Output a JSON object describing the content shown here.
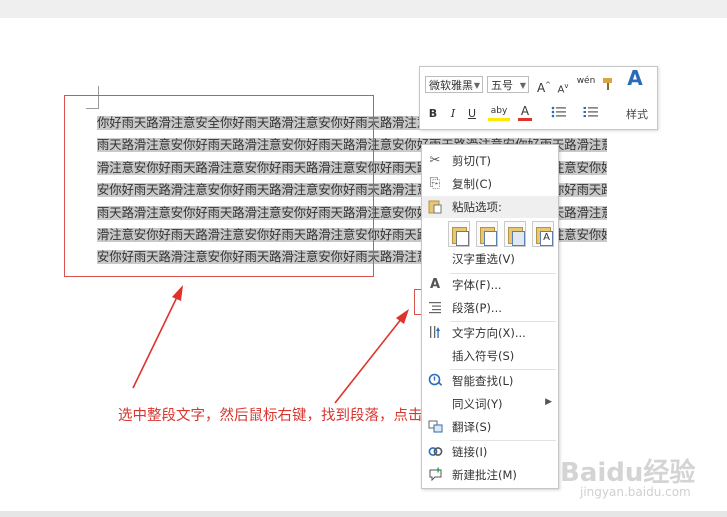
{
  "document": {
    "lines": [
      "你好雨天路滑注意安全你好雨天路滑注意安你好雨天路滑注意安你好雨天路滑注意安你好雨天路滑注意安",
      "雨天路滑注意安你好雨天路滑注意安你好雨天路滑注意安你好雨天路滑注意安你好雨天路滑注意安你好雨天路",
      "滑注意安你好雨天路滑注意安你好雨天路滑注意安你好雨天路滑注意安你好雨天路滑注意安你好雨天路滑注意",
      "安你好雨天路滑注意安你好雨天路滑注意安你好雨天路滑注意安你好雨天路滑注意安你好雨天路滑注意安你好",
      "雨天路滑注意安你好雨天路滑注意安你好雨天路滑注意安你好雨天路滑注意安你好雨天路滑注意安你好雨天路",
      "滑注意安你好雨天路滑注意安你好雨天路滑注意安你好雨天路滑注意安你好雨天路滑注意安你好雨天路滑注意",
      "安你好雨天路滑注意安你好雨天路滑注意安你好雨天路滑注意安你好雨天路滑"
    ]
  },
  "mini_toolbar": {
    "font_name": "微软雅黑",
    "font_size": "五号",
    "grow_font": "A",
    "shrink_font": "A",
    "phonetic": "wén",
    "bold": "B",
    "italic": "I",
    "underline": "U",
    "highlight": "aby",
    "font_color": "A",
    "styles_label": "样式"
  },
  "context_menu": {
    "cut": "剪切(T)",
    "copy": "复制(C)",
    "paste_options": "粘贴选项:",
    "reconvert": "汉字重选(V)",
    "font": "字体(F)...",
    "paragraph": "段落(P)...",
    "text_direction": "文字方向(X)...",
    "insert_symbol": "插入符号(S)",
    "smart_lookup": "智能查找(L)",
    "synonyms": "同义词(Y)",
    "translate": "翻译(S)",
    "link": "链接(I)",
    "new_comment": "新建批注(M)"
  },
  "annotation": "选中整段文字，然后鼠标右键，找到段落，点击段落",
  "watermark": {
    "main": "Baidu经验",
    "sub": "jingyan.baidu.com"
  },
  "colors": {
    "annotation_red": "#d9352f",
    "selection_gray": "#c9c9c9"
  }
}
